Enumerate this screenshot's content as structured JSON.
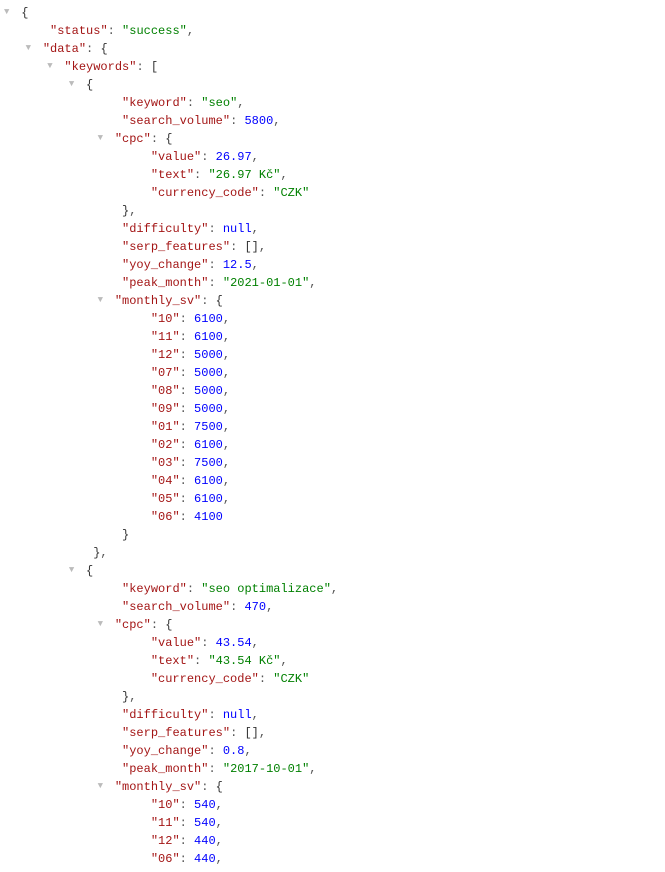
{
  "glyphs": {
    "toggle": "▼"
  },
  "json": {
    "brace_open": "{",
    "brace_close": "}",
    "bracket_open": "[",
    "bracket_close": "]",
    "comma": ",",
    "colon": ":",
    "quote": "\"",
    "status_key": "status",
    "status_val": "success",
    "data_key": "data",
    "keywords_key": "keywords",
    "keyword_key": "keyword",
    "search_volume_key": "search_volume",
    "cpc_key": "cpc",
    "value_key": "value",
    "text_key": "text",
    "currency_code_key": "currency_code",
    "difficulty_key": "difficulty",
    "serp_features_key": "serp_features",
    "yoy_change_key": "yoy_change",
    "peak_month_key": "peak_month",
    "monthly_sv_key": "monthly_sv",
    "null_val": "null",
    "kw1": {
      "keyword": "seo",
      "search_volume": "5800",
      "cpc_value": "26.97",
      "cpc_text": "26.97 Kč",
      "currency_code": "CZK",
      "yoy_change": "12.5",
      "peak_month": "2021-01-01",
      "monthly": {
        "k10": "10",
        "v10": "6100",
        "k11": "11",
        "v11": "6100",
        "k12": "12",
        "v12": "5000",
        "k07": "07",
        "v07": "5000",
        "k08": "08",
        "v08": "5000",
        "k09": "09",
        "v09": "5000",
        "k01": "01",
        "v01": "7500",
        "k02": "02",
        "v02": "6100",
        "k03": "03",
        "v03": "7500",
        "k04": "04",
        "v04": "6100",
        "k05": "05",
        "v05": "6100",
        "k06": "06",
        "v06": "4100"
      }
    },
    "kw2": {
      "keyword": "seo optimalizace",
      "search_volume": "470",
      "cpc_value": "43.54",
      "cpc_text": "43.54 Kč",
      "currency_code": "CZK",
      "yoy_change": "0.8",
      "peak_month": "2017-10-01",
      "monthly": {
        "k10": "10",
        "v10": "540",
        "k11": "11",
        "v11": "540",
        "k12": "12",
        "v12": "440",
        "k06": "06",
        "v06": "440"
      }
    }
  }
}
